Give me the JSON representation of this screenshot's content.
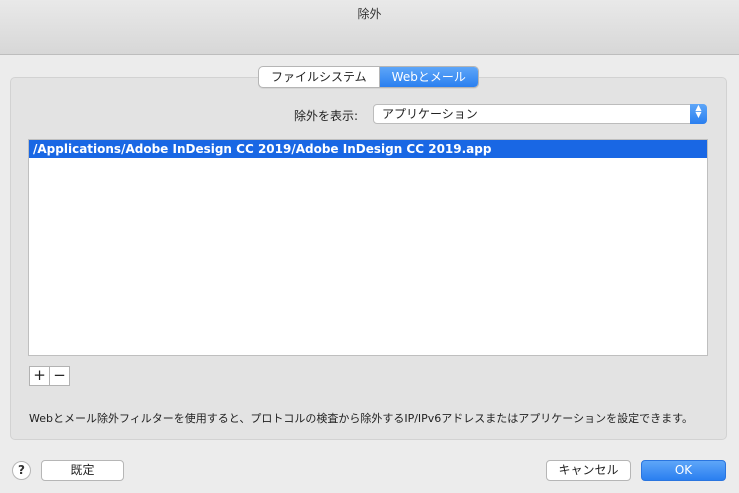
{
  "window": {
    "title": "除外"
  },
  "tabs": [
    {
      "label": "ファイルシステム",
      "active": false
    },
    {
      "label": "Webとメール",
      "active": true
    }
  ],
  "filter": {
    "label": "除外を表示:",
    "selected": "アプリケーション"
  },
  "exclusions": {
    "items": [
      {
        "path": "/Applications/Adobe InDesign CC 2019/Adobe InDesign CC 2019.app",
        "selected": true
      }
    ]
  },
  "controls": {
    "add_label": "+",
    "remove_label": "−"
  },
  "info_text": "Webとメール除外フィルターを使用すると、プロトコルの検査から除外するIP/IPv6アドレスまたはアプリケーションを設定できます。",
  "footer": {
    "help_label": "?",
    "default_label": "既定",
    "cancel_label": "キャンセル",
    "ok_label": "OK"
  },
  "colors": {
    "accent": "#2a7ff0",
    "selection": "#1967e4"
  }
}
